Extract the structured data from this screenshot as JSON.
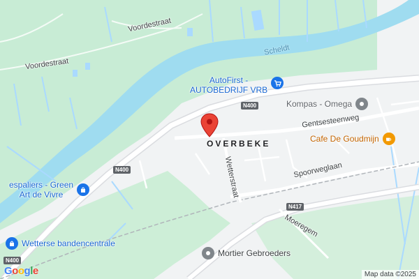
{
  "colors": {
    "land": "#f1f3f4",
    "park": "#c8ecd5",
    "water": "#aadaff",
    "river": "#9fdcf0",
    "road": "#ffffff",
    "highway": "#e8eaed",
    "shop_blue": "#1a73e8",
    "food_orange": "#f29900",
    "generic_gray": "#80868b",
    "marker_red": "#ea4335"
  },
  "streets": {
    "voordestraat_1": "Voordestraat",
    "voordestraat_2": "Voordestraat",
    "gentsesteenweg": "Gentsesteenweg",
    "wetterstraat": "Wetterstraat",
    "spoorweglaan": "Spoorweglaan",
    "moeregem": "Moeregem"
  },
  "water": {
    "scheldt": "Scheldt"
  },
  "place": {
    "name": "OVERBEKE"
  },
  "shields": {
    "n400_top": "N400",
    "n400_left": "N400",
    "n400_bottom": "N400",
    "n417": "N417"
  },
  "pois": {
    "autofirst": {
      "line1": "AutoFirst -",
      "line2": "AUTOBEDRIJF VRB",
      "icon": "shopping-cart-icon"
    },
    "kompas": {
      "name": "Kompas - Omega",
      "icon": "generic-pin-icon"
    },
    "cafe": {
      "name": "Cafe De Goudmijn",
      "icon": "coffee-cup-icon"
    },
    "espaliers": {
      "line1": "espaliers - Green",
      "line2": "Art de Vivre",
      "icon": "shopping-bag-icon"
    },
    "wetterse": {
      "name": "Wetterse bandencentrale",
      "icon": "shopping-bag-icon"
    },
    "mortier": {
      "name": "Mortier Gebroeders",
      "icon": "generic-pin-icon"
    }
  },
  "logo": {
    "G": "G",
    "o1": "o",
    "o2": "o",
    "g": "g",
    "l": "l",
    "e": "e"
  },
  "attribution": "Map data ©2025"
}
